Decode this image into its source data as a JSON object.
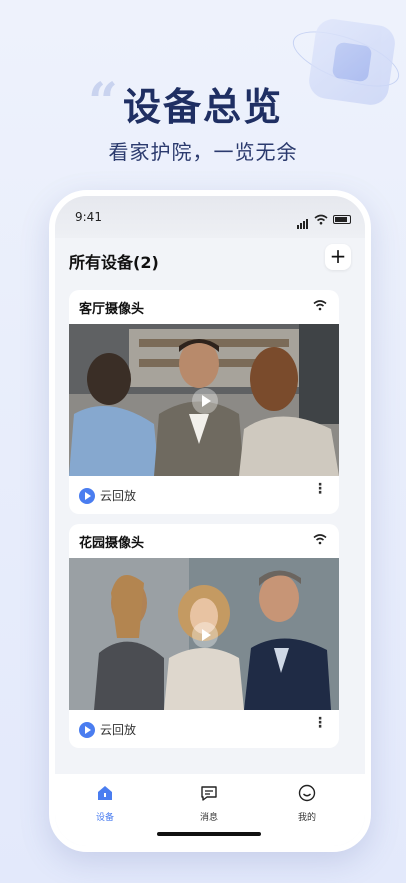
{
  "hero": {
    "quote_mark": "“",
    "title": "设备总览",
    "subtitle": "看家护院，一览无余"
  },
  "status_bar": {
    "time": "9:41"
  },
  "header": {
    "title": "所有设备(2)",
    "add_label": "+"
  },
  "devices": [
    {
      "name": "客厅摄像头",
      "cloud_label": "云回放",
      "more_label": "⋮",
      "icon": "wifi-icon"
    },
    {
      "name": "花园摄像头",
      "cloud_label": "云回放",
      "more_label": "⋮",
      "icon": "wifi-icon"
    }
  ],
  "tabs": [
    {
      "label": "设备",
      "icon": "home-icon",
      "active": true
    },
    {
      "label": "消息",
      "icon": "message-icon",
      "active": false
    },
    {
      "label": "我的",
      "icon": "profile-icon",
      "active": false
    }
  ],
  "colors": {
    "accent": "#4a7df0",
    "title": "#1f2f63"
  }
}
